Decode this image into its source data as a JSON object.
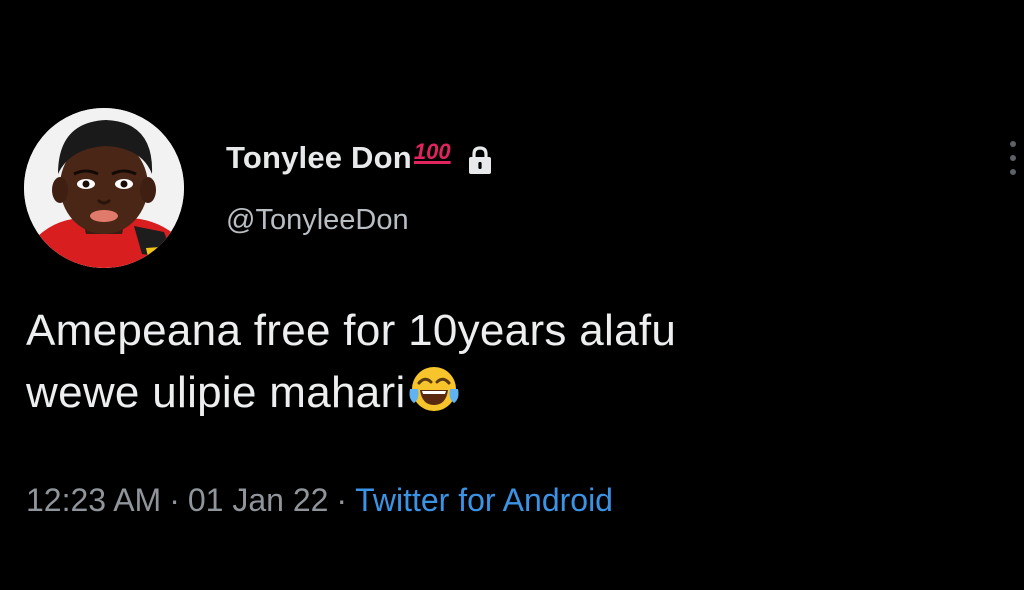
{
  "user": {
    "display_name": "Tonylee Don",
    "badge": "100",
    "handle": "@TonyleeDon",
    "protected": true
  },
  "tweet": {
    "line1": "Amepeana free for 10years alafu",
    "line2": "wewe ulipie mahari",
    "emoji": "tears-of-joy-emoji"
  },
  "meta": {
    "time": "12:23 AM",
    "separator": "·",
    "date": "01 Jan 22",
    "source": "Twitter for Android"
  },
  "colors": {
    "background": "#000000",
    "text": "#e7e9ea",
    "muted": "#8f959a",
    "link": "#3a93e4",
    "badge": "#e0245e"
  },
  "icons": {
    "more": "more-vertical-icon",
    "lock": "lock-icon",
    "hundred": "hundred-points-icon"
  }
}
